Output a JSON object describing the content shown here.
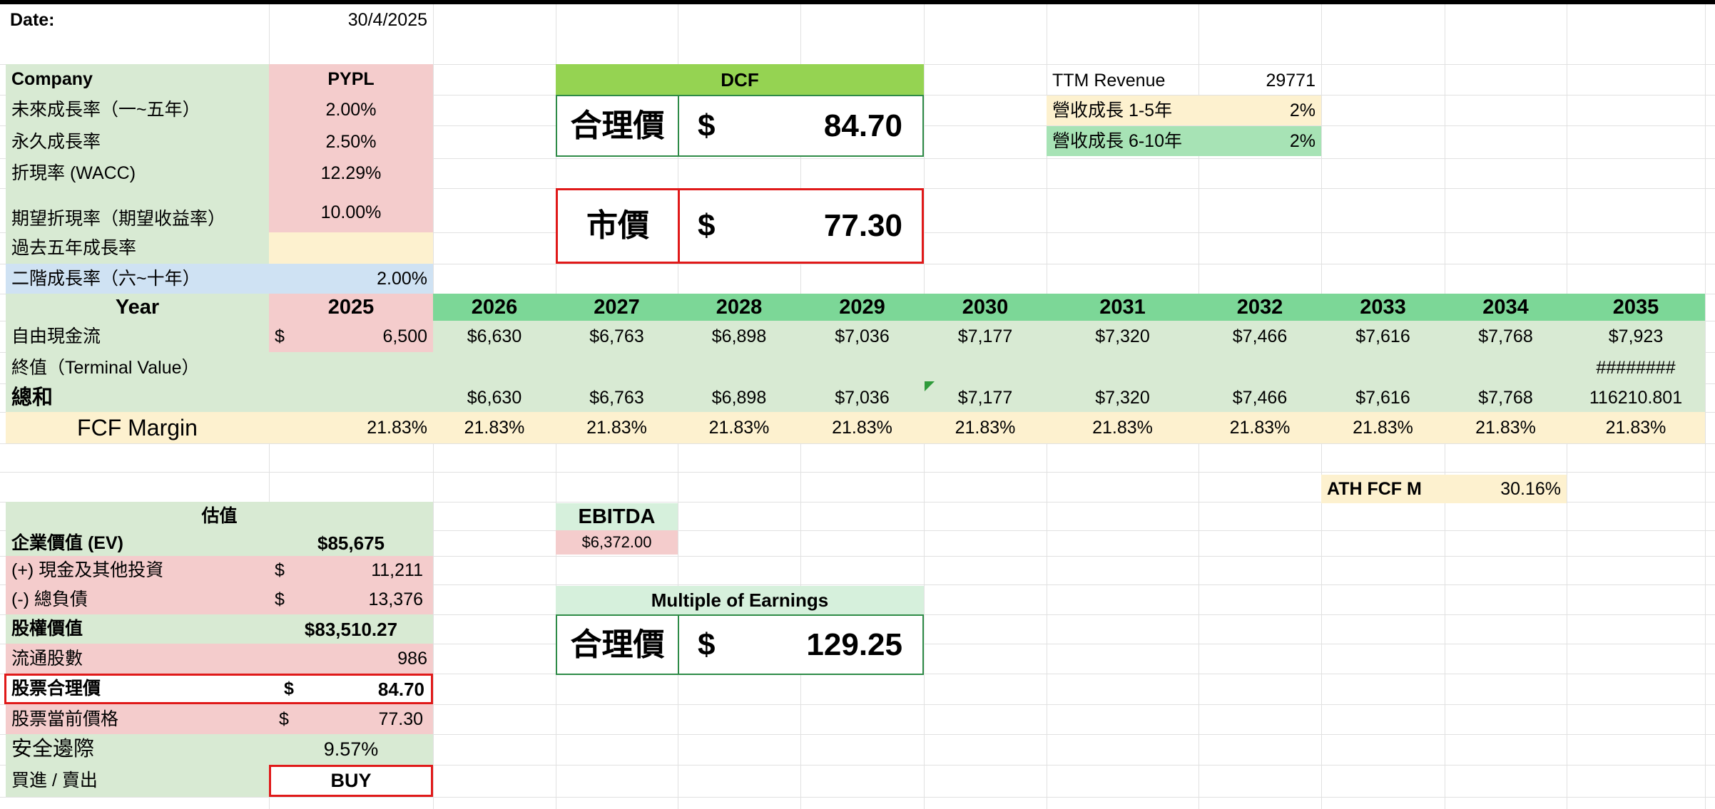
{
  "header": {
    "date_label": "Date:",
    "date_value": "30/4/2025"
  },
  "inputs": {
    "company_label": "Company",
    "company_value": "PYPL",
    "growth_label": "未來成長率（一~五年）",
    "growth_value": "2.00%",
    "perpetual_label": "永久成長率",
    "perpetual_value": "2.50%",
    "wacc_label": "折現率 (WACC)",
    "wacc_value": "12.29%",
    "expected_label": "期望折現率（期望收益率）",
    "expected_value": "10.00%",
    "past_label": "過去五年成長率",
    "past_value": "",
    "stage2_label": "二階成長率（六~十年）",
    "stage2_value": "2.00%"
  },
  "dcf": {
    "title": "DCF",
    "fair_label": "合理價",
    "fair_currency": "$",
    "fair_value": "84.70",
    "market_label": "市價",
    "market_currency": "$",
    "market_value": "77.30"
  },
  "revenue": {
    "ttm_label": "TTM Revenue",
    "ttm_value": "29771",
    "g15_label": "營收成長 1-5年",
    "g15_value": "2%",
    "g610_label": "營收成長 6-10年",
    "g610_value": "2%"
  },
  "table": {
    "year_label": "Year",
    "fcf_label": "自由現金流",
    "fcf_first_currency": "$",
    "fcf_first_value": "6,500",
    "tv_label": "終值（Terminal Value）",
    "sum_label": "總和",
    "margin_label": "FCF Margin",
    "years": [
      "2025",
      "2026",
      "2027",
      "2028",
      "2029",
      "2030",
      "2031",
      "2032",
      "2033",
      "2034",
      "2035"
    ],
    "fcf": [
      "$6,630",
      "$6,763",
      "$6,898",
      "$7,036",
      "$7,177",
      "$7,320",
      "$7,466",
      "$7,616",
      "$7,768",
      "$7,923"
    ],
    "tv": [
      "",
      "",
      "",
      "",
      "",
      "",
      "",
      "",
      "",
      "########"
    ],
    "sum": [
      "$6,630",
      "$6,763",
      "$6,898",
      "$7,036",
      "$7,177",
      "$7,320",
      "$7,466",
      "$7,616",
      "$7,768",
      "116210.801"
    ],
    "margin": [
      "21.83%",
      "21.83%",
      "21.83%",
      "21.83%",
      "21.83%",
      "21.83%",
      "21.83%",
      "21.83%",
      "21.83%",
      "21.83%",
      "21.83%"
    ]
  },
  "ath": {
    "label": "ATH FCF M",
    "value": "30.16%"
  },
  "valuation": {
    "title": "估值",
    "ev_label": "企業價值 (EV)",
    "ev_value": "$85,675",
    "cash_label": "(+) 現金及其他投資",
    "cash_currency": "$",
    "cash_value": "11,211",
    "debt_label": "(-) 總負債",
    "debt_currency": "$",
    "debt_value": "13,376",
    "equity_label": "股權價值",
    "equity_value": "$83,510.27",
    "shares_label": "流通股數",
    "shares_value": "986",
    "fair_label": "股票合理價",
    "fair_currency": "$",
    "fair_value": "84.70",
    "price_label": "股票當前價格",
    "price_currency": "$",
    "price_value": "77.30",
    "margin_label": "安全邊際",
    "margin_value": "9.57%",
    "action_label": "買進 / 賣出",
    "action_value": "BUY"
  },
  "ebitda": {
    "label": "EBITDA",
    "value": "$6,372.00"
  },
  "multiple": {
    "title": "Multiple of Earnings",
    "fair_label": "合理價",
    "fair_currency": "$",
    "fair_value": "129.25"
  },
  "colors": {
    "green_fill": "#d8ead3",
    "pink_fill": "#f4cccc",
    "header_green": "#7cd797",
    "dcf_green": "#95d352",
    "red_border": "#e01919"
  }
}
